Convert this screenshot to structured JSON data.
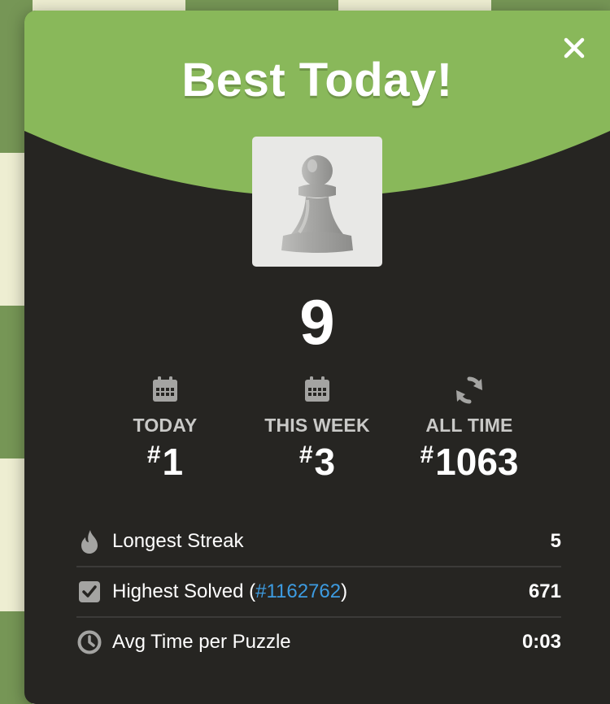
{
  "modal": {
    "title": "Best Today!",
    "close_icon": "close-icon",
    "piece_icon": "pawn-icon",
    "score": "9",
    "colors": {
      "header_green": "#89b85a",
      "panel_dark": "#262522",
      "link_blue": "#3d9be0",
      "label_gray": "#c9c9c7"
    }
  },
  "ranks": [
    {
      "icon": "calendar-icon",
      "label": "TODAY",
      "hash": "#",
      "value": "1"
    },
    {
      "icon": "calendar-icon",
      "label": "THIS WEEK",
      "hash": "#",
      "value": "3"
    },
    {
      "icon": "refresh-icon",
      "label": "ALL TIME",
      "hash": "#",
      "value": "1063"
    }
  ],
  "stats": [
    {
      "icon": "flame-icon",
      "label": "Longest Streak",
      "value": "5"
    },
    {
      "icon": "checkbox-icon",
      "label_prefix": "Highest Solved (",
      "link": "#1162762",
      "label_suffix": ")",
      "value": "671"
    },
    {
      "icon": "clock-icon",
      "label": "Avg Time per Puzzle",
      "value": "0:03"
    }
  ]
}
